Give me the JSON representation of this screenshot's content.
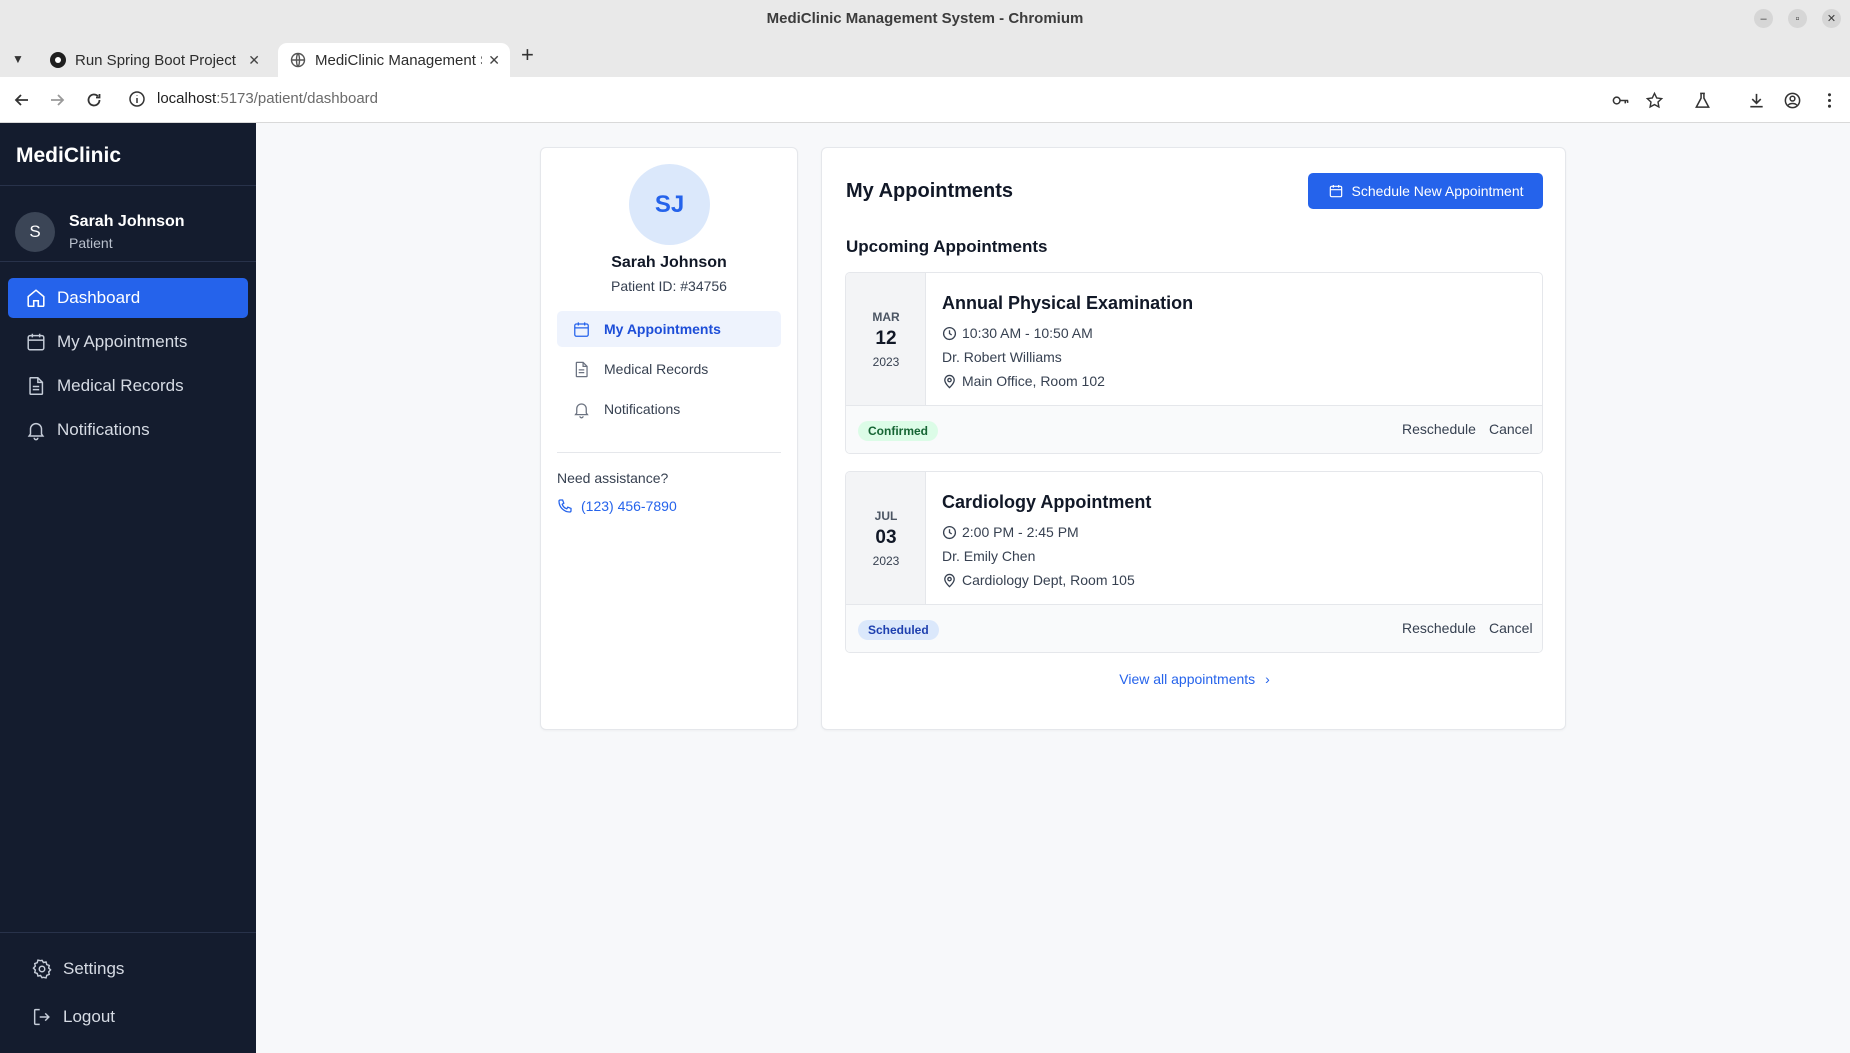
{
  "browser": {
    "window_title": "MediClinic Management System - Chromium",
    "tabs": [
      {
        "label": "Run Spring Boot Project"
      },
      {
        "label": "MediClinic Management System"
      }
    ],
    "url_host": "localhost",
    "url_path": ":5173/patient/dashboard"
  },
  "sidebar": {
    "brand": "MediClinic",
    "user": {
      "initial": "S",
      "name": "Sarah Johnson",
      "role": "Patient"
    },
    "items": [
      {
        "label": "Dashboard",
        "icon": "home-icon",
        "active": true
      },
      {
        "label": "My Appointments",
        "icon": "calendar-icon"
      },
      {
        "label": "Medical Records",
        "icon": "document-icon"
      },
      {
        "label": "Notifications",
        "icon": "bell-icon"
      }
    ],
    "bottom": [
      {
        "label": "Settings",
        "icon": "gear-icon"
      },
      {
        "label": "Logout",
        "icon": "logout-icon"
      }
    ]
  },
  "profile": {
    "initials": "SJ",
    "name": "Sarah Johnson",
    "patient_id": "Patient ID: #34756",
    "links": [
      {
        "label": "My Appointments",
        "icon": "calendar-icon",
        "active": true
      },
      {
        "label": "Medical Records",
        "icon": "document-icon"
      },
      {
        "label": "Notifications",
        "icon": "bell-icon"
      }
    ],
    "assist_label": "Need assistance?",
    "phone": "(123) 456-7890"
  },
  "appointments": {
    "title": "My Appointments",
    "schedule_button": "Schedule New Appointment",
    "subtitle": "Upcoming Appointments",
    "items": [
      {
        "month": "MAR",
        "day": "12",
        "year": "2023",
        "title": "Annual Physical Examination",
        "time": "10:30 AM - 10:50 AM",
        "doctor": "Dr. Robert Williams",
        "location": "Main Office, Room 102",
        "status": "Confirmed",
        "reschedule": "Reschedule",
        "cancel": "Cancel"
      },
      {
        "month": "JUL",
        "day": "03",
        "year": "2023",
        "title": "Cardiology Appointment",
        "time": "2:00 PM - 2:45 PM",
        "doctor": "Dr. Emily Chen",
        "location": "Cardiology Dept, Room 105",
        "status": "Scheduled",
        "reschedule": "Reschedule",
        "cancel": "Cancel"
      }
    ],
    "view_all": "View all appointments"
  },
  "colors": {
    "sidebar_bg": "#141c2e",
    "accent": "#2563eb",
    "confirmed_badge": "#dcfce7",
    "scheduled_badge": "#dbe8fb"
  }
}
